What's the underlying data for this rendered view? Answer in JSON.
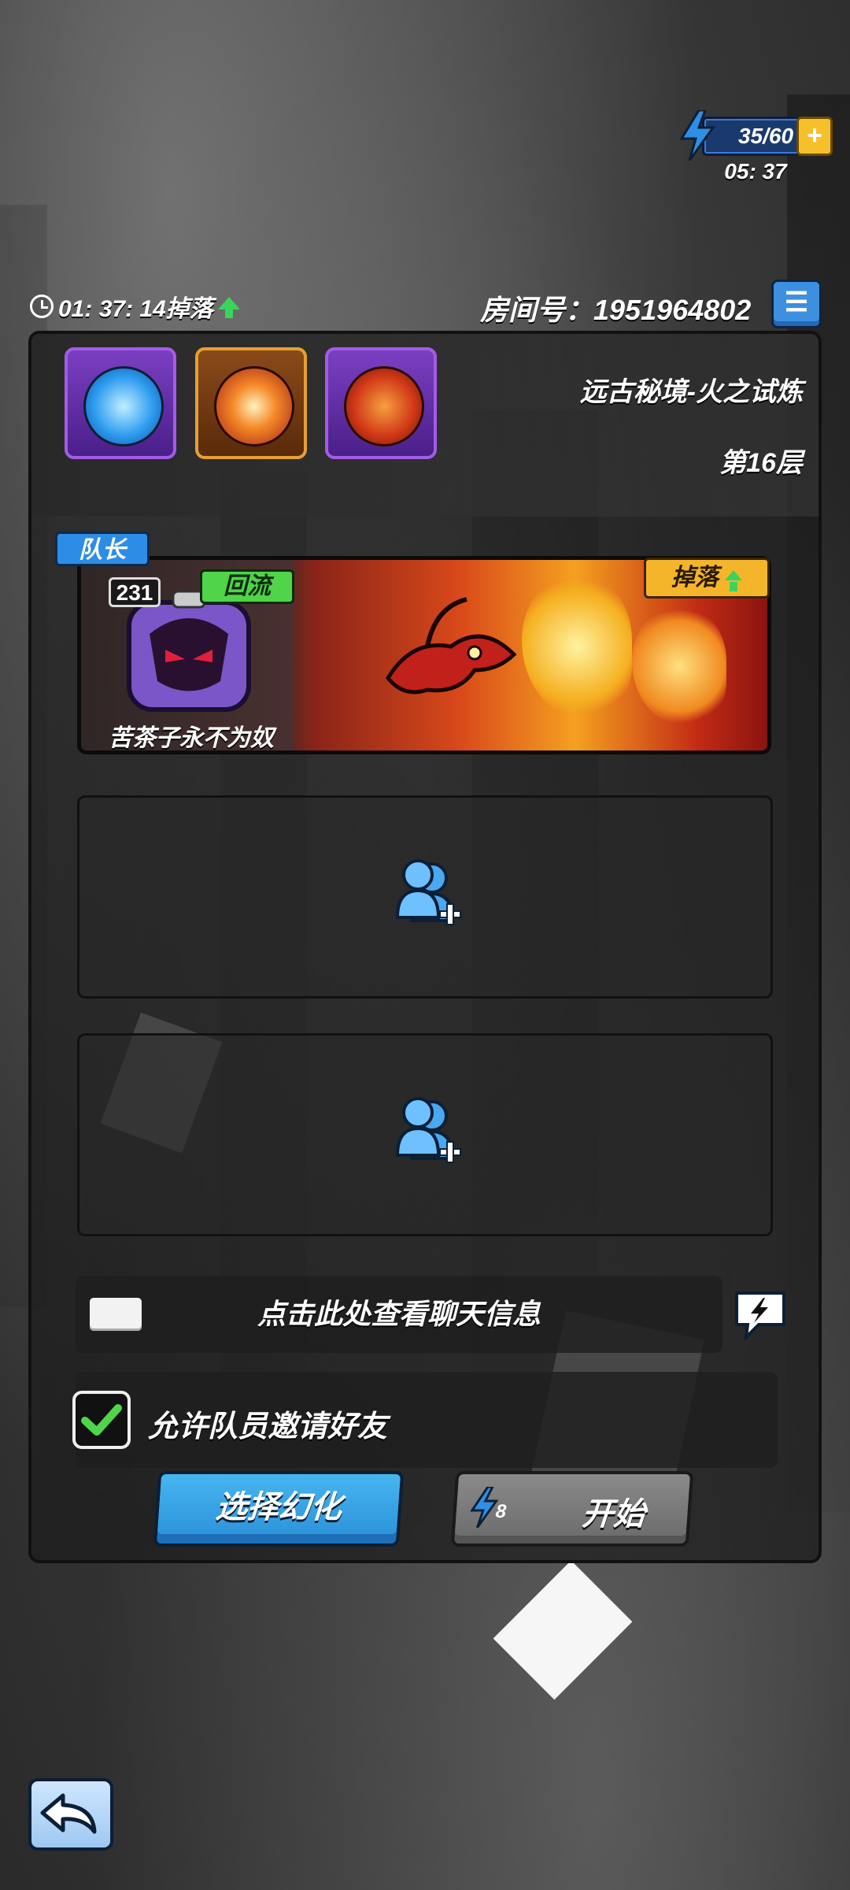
{
  "energy": {
    "value": "35/60",
    "timer": "05: 37"
  },
  "header": {
    "drop_timer": "01: 37: 14掉落",
    "room_label": "房间号：",
    "room_number": "1951964802"
  },
  "dungeon": {
    "name": "远古秘境-火之试炼",
    "floor": "第16层"
  },
  "leader": {
    "tag": "队长",
    "level": "231",
    "status_badge": "回流",
    "name": "苦茶子永不为奴",
    "drop_badge": "掉落"
  },
  "chat": {
    "hint": "点击此处查看聊天信息"
  },
  "invite": {
    "label": "允许队员邀请好友",
    "checked": true
  },
  "buttons": {
    "select_illusion": "选择幻化",
    "start": "开始",
    "start_cost": "8"
  },
  "colors": {
    "accent_blue": "#2a8fd8",
    "drop_gold": "#f5b52a",
    "return_green": "#4fd44a"
  }
}
